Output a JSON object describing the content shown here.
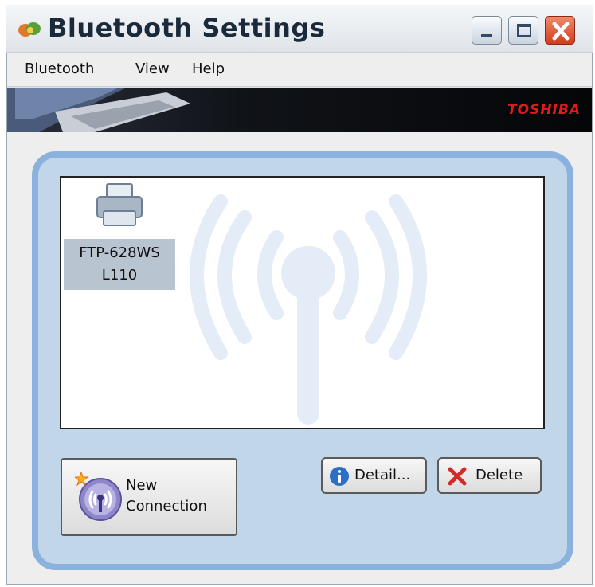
{
  "window": {
    "title": "Bluetooth Settings"
  },
  "menu": {
    "items": [
      "Bluetooth",
      "View",
      "Help"
    ]
  },
  "banner": {
    "brand": "TOSHIBA"
  },
  "devices": [
    {
      "name": "FTP-628WS L110",
      "line1": "FTP-628WS",
      "line2": "L110",
      "icon": "printer-icon"
    }
  ],
  "buttons": {
    "new_connection": "New\nConnection",
    "detail": "Detail...",
    "delete": "Delete"
  },
  "colors": {
    "panel": "#c2d6ea",
    "panel_border": "#8ab2dc",
    "brand_red": "#e01b1b",
    "close_button": "#d23c1c"
  }
}
